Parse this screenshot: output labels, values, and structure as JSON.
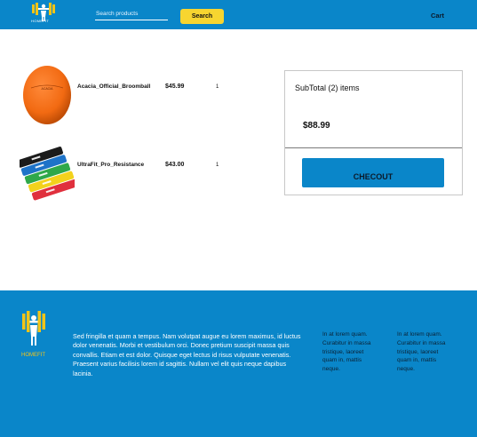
{
  "header": {
    "logo_text": "HOMEFIT",
    "search_placeholder": "Search products",
    "search_button": "Search",
    "cart_label": "Cart"
  },
  "cart": {
    "items": [
      {
        "name": "Acacia_Official_Broomball",
        "price": "$45.99",
        "quantity": "1",
        "image": "orange-ball"
      },
      {
        "name": "UltraFit_Pro_Resistance",
        "price": "$43.00",
        "quantity": "1",
        "image": "resistance-bands"
      }
    ]
  },
  "summary": {
    "subtotal_label": "SubTotal (2) items",
    "subtotal_value": "$88.99",
    "checkout_button": "CHECOUT"
  },
  "footer": {
    "logo_text": "HOMEFIT",
    "description": "Sed fringilla et quam a tempus. Nam volutpat augue eu lorem maximus, id luctus dolor venenatis. Morbi et vestibulum orci. Donec pretium suscipit massa quis convallis. Etiam et est dolor. Quisque eget lectus id risus vulputate venenatis. Praesent varius facilisis lorem id sagittis. Nullam vel elit quis neque dapibus lacinia.",
    "col1": "In at lorem quam. Curabitur in massa tristique, laoreet quam in, mattis neque.",
    "col2": "In at lorem quam. Curabitur in massa tristique, laoreet quam in, mattis neque."
  },
  "colors": {
    "primary": "#0a86c9",
    "accent": "#f7d530",
    "logo_yellow": "#f2c418"
  }
}
